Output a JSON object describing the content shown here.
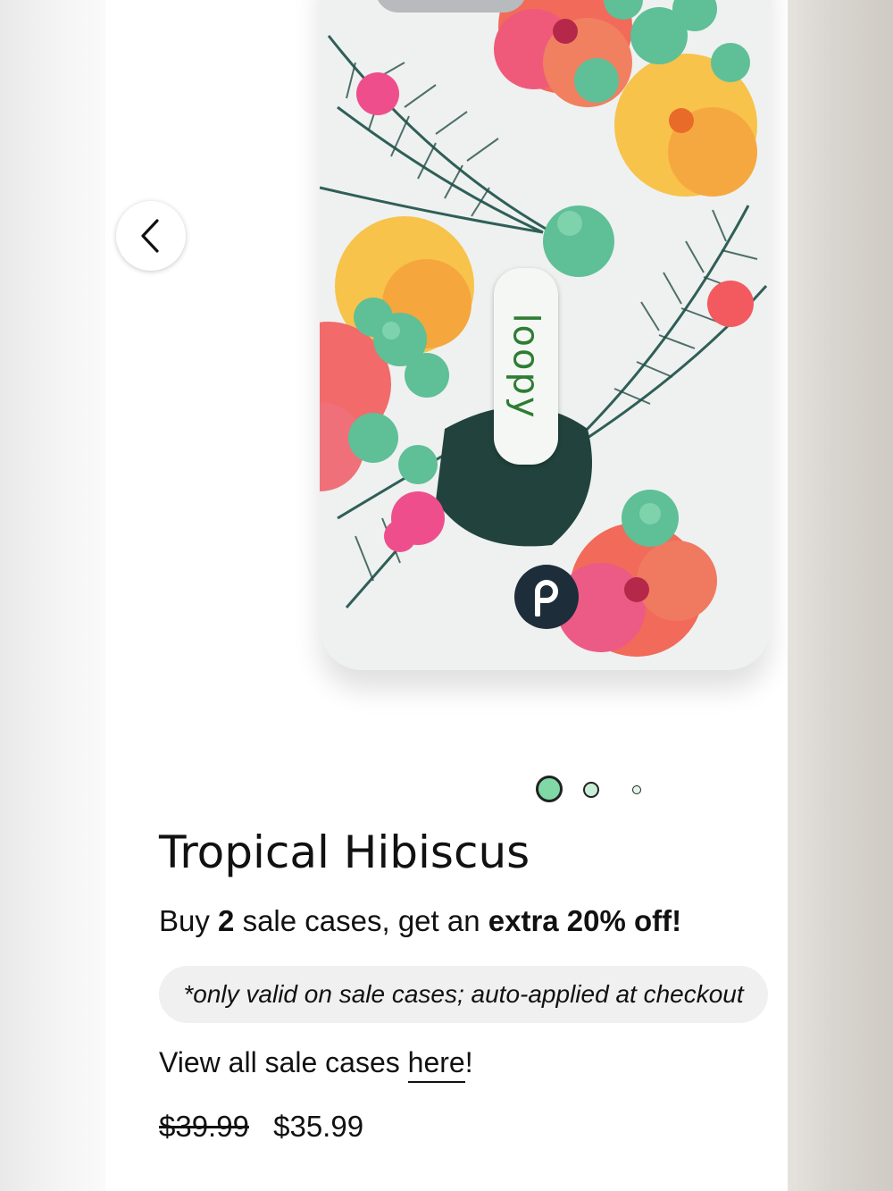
{
  "product": {
    "title": "Tropical Hibiscus",
    "grip_brand": "loopy",
    "logo_letter": "p",
    "promo": {
      "prefix": "Buy ",
      "count": "2",
      "middle": " sale cases, get an ",
      "bold": "extra 20% off!"
    },
    "note": "*only valid on sale cases; auto-applied at checkout",
    "view_all": {
      "prefix": "View all sale cases ",
      "link": "here",
      "suffix": "!"
    },
    "price": {
      "original": "$39.99",
      "sale": "$35.99"
    }
  },
  "carousel": {
    "current_slide": 1,
    "slide_count": 3
  },
  "icons": {
    "back": "chevron-left-icon",
    "brand": "loopy-logo-icon"
  },
  "colors": {
    "active_dot": "#7fd8a6",
    "grip_text": "#2e7d32",
    "logo_bg": "#1d2d3a"
  }
}
